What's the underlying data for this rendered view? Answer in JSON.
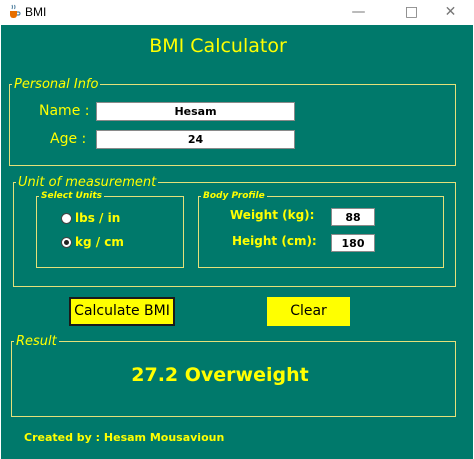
{
  "window": {
    "title": "BMI",
    "minimize_glyph": "—",
    "maximize_glyph": "□",
    "close_glyph": "✕",
    "icon": "java-cup-icon"
  },
  "app": {
    "title": "BMI Calculator"
  },
  "personal_info": {
    "legend": "Personal Info",
    "name_label": "Name :",
    "name_value": "Hesam",
    "age_label": "Age :",
    "age_value": "24"
  },
  "unit_of_measurement": {
    "legend": "Unit of measurement",
    "select_units": {
      "legend": "Select Units",
      "options": [
        {
          "label": "lbs / in",
          "selected": false
        },
        {
          "label": "kg / cm",
          "selected": true
        }
      ]
    },
    "body_profile": {
      "legend": "Body Profile",
      "weight_label": "Weight (kg):",
      "weight_value": "88",
      "height_label": "Height (cm):",
      "height_value": "180"
    }
  },
  "buttons": {
    "calculate": "Calculate BMI",
    "clear": "Clear"
  },
  "result": {
    "legend": "Result",
    "value": "27.2 Overweight"
  },
  "footer": {
    "credit": "Created by : Hesam Mousavioun"
  },
  "colors": {
    "background": "#00796b",
    "accent": "#ffff00",
    "border": "#e5e07a"
  }
}
